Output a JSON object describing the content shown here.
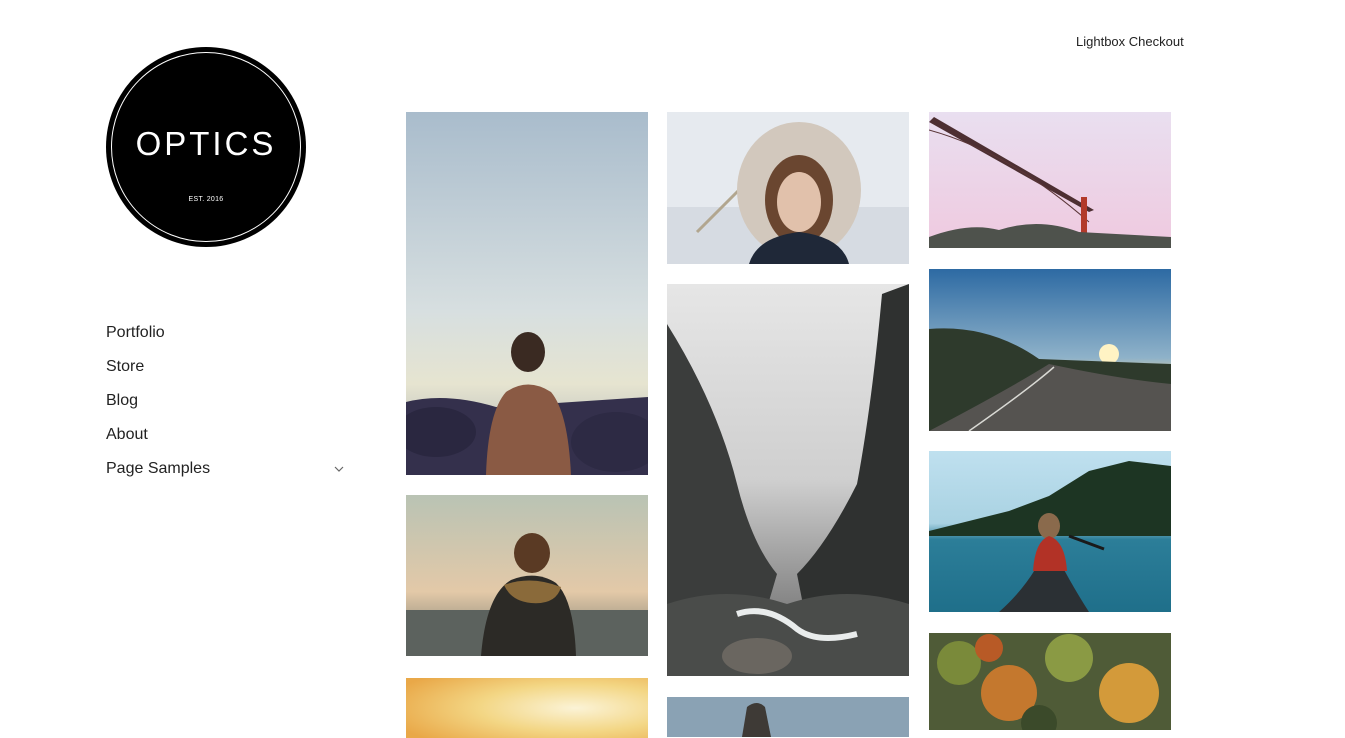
{
  "header": {
    "checkout_label": "Lightbox Checkout"
  },
  "logo": {
    "title": "OPTICS",
    "subtitle": "EST. 2016"
  },
  "nav": {
    "items": [
      {
        "label": "Portfolio"
      },
      {
        "label": "Store"
      },
      {
        "label": "Blog"
      },
      {
        "label": "About"
      },
      {
        "label": "Page Samples",
        "has_submenu": true,
        "icon": "chevron-down-icon"
      }
    ]
  },
  "gallery": {
    "photos": [
      "man-on-rocks-by-sea",
      "woman-in-fur-hood",
      "golden-gate-bridge",
      "mountain-road-sunset",
      "misty-canyon-waterfall",
      "man-with-scarf-at-sea",
      "woman-in-canoe-on-lake",
      "sunset-sky",
      "flatiron-building",
      "autumn-forest-aerial"
    ]
  }
}
